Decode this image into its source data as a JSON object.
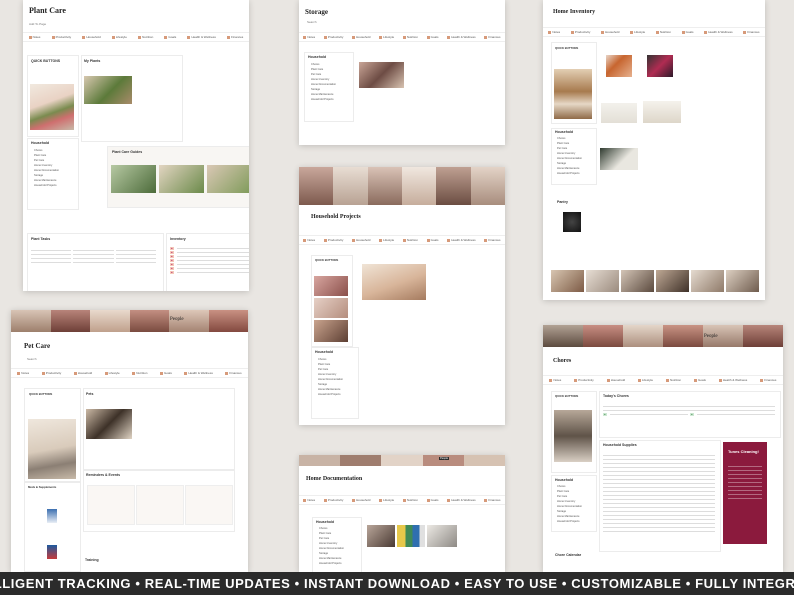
{
  "panels": {
    "plant_care": {
      "title": "Plant Care",
      "my_plants": "My Plants",
      "guides": "Plant Care Guides",
      "tasks": "Plant Tasks",
      "inventory": "Inventory",
      "quick_buttons": "QUICK BUTTONS",
      "household": "Household"
    },
    "storage": {
      "title": "Storage",
      "household": "Household"
    },
    "home_inventory": {
      "title": "Home Inventory",
      "quick_buttons": "QUICK BUTTONS",
      "household": "Household",
      "pantry": "Pantry"
    },
    "household_projects": {
      "title": "Household Projects",
      "quick_buttons": "QUICK BUTTONS",
      "household": "Household"
    },
    "pet_care": {
      "title": "Pet Care",
      "banner_tag": "People",
      "quick_buttons": "QUICK BUTTONS",
      "pets": "Pets",
      "reminders": "Reminders & Events",
      "meds": "Meds & Supplements",
      "training": "Training"
    },
    "home_documentation": {
      "title": "Home Documentation",
      "household": "Household",
      "banner_tag": "People"
    },
    "chores": {
      "title": "Chores",
      "banner_tag": "People",
      "today": "Today's Chores",
      "supplies": "Household Supplies",
      "calendar": "Chore Calendar",
      "quick_buttons": "QUICK BUTTONS",
      "household": "Household",
      "widget_title": "Tunes Cleaning!"
    }
  },
  "nav_items": [
    "Notes",
    "Productivity",
    "Household",
    "Lifestyle",
    "Nutrition",
    "Goals",
    "Health & Wellness",
    "Finances"
  ],
  "sidebar_items": [
    "Chores",
    "Plant Care",
    "Pet Care",
    "Home Inventory",
    "Home Documentation",
    "Storage",
    "Home Maintenance",
    "Household Projects"
  ],
  "footer": {
    "text": "INTELLIGENT TRACKING • REAL-TIME UPDATES • INSTANT DOWNLOAD • EASY TO USE • CUSTOMIZABLE • FULLY INTEGRATED"
  },
  "colors": {
    "accent": "#d79a7a",
    "footer_bg": "#2b2b2b",
    "widget": "#8b1a3d"
  }
}
